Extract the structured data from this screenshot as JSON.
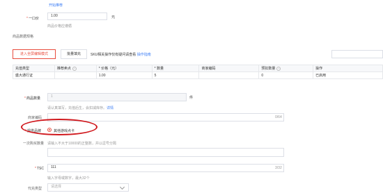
{
  "top_link": "开始推荐",
  "price": {
    "label": "一口价",
    "value": "1.00",
    "unit": "元",
    "hint": "商品价格应遵循"
  },
  "sku_header": "商品数据规格",
  "toolbar": {
    "enter_full_btn": "进入全屏编辑模式",
    "batch_fill_btn": "批量填充",
    "note_prefix": "SKU相关操作仅有疑问请查看",
    "note_link": "操作指南"
  },
  "table": {
    "columns": [
      "充值类型",
      "推荐卖点",
      "* 价格（元）",
      "* 数量",
      "商家编码",
      "预扣数量",
      "操作"
    ],
    "rows": [
      [
        "盛大通行证",
        "",
        "1.00",
        "5",
        "",
        "0",
        "已启用"
      ]
    ]
  },
  "quantity": {
    "label": "商品数量",
    "value": "1",
    "unit": "件",
    "hint_prefix": "请认真填写，充值后生，会扣减库存。",
    "hint_link": "详情"
  },
  "merchant_code": {
    "label": "商家编码",
    "counter": "0/64"
  },
  "brand": {
    "label": "提供品牌",
    "option": "其他游戏点卡"
  },
  "limit": {
    "label": "一次购买数量",
    "hint": "请输入不大于10000的正整数，并以逗号分隔"
  },
  "tsc": {
    "label": "TSC",
    "value": "111",
    "counter": "3/32",
    "hint": "输入字母或数字，最大32个"
  },
  "charge_type": {
    "label": "代充类型",
    "placeholder": "请选择"
  }
}
